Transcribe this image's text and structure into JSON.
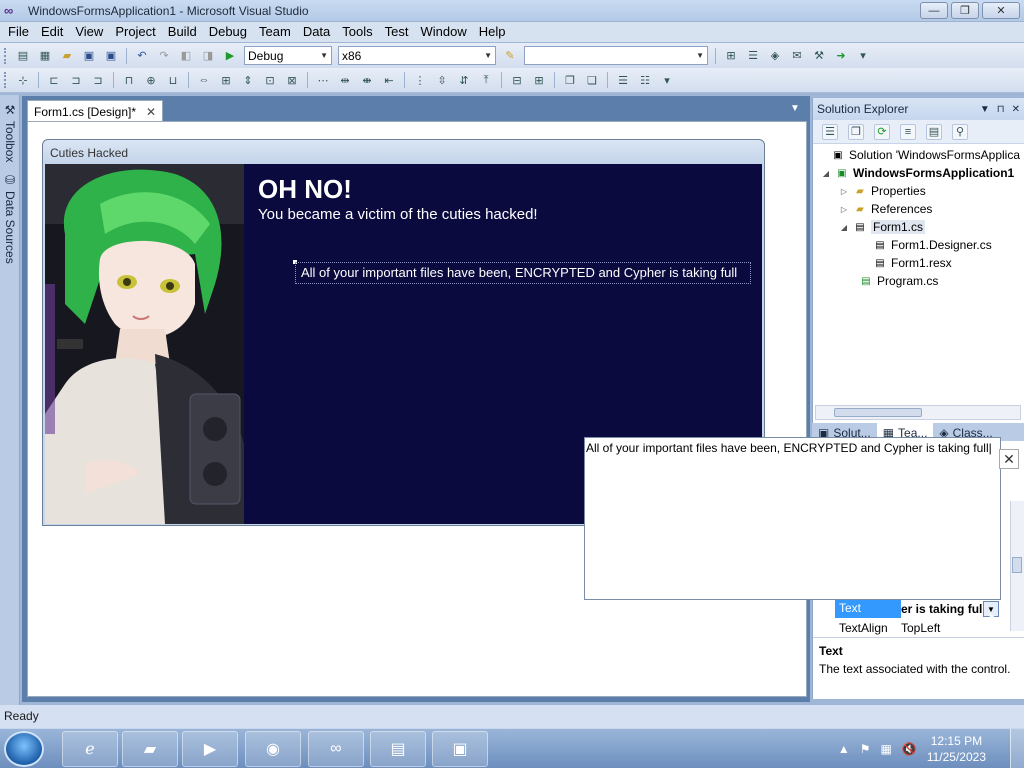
{
  "window": {
    "title": "WindowsFormsApplication1 - Microsoft Visual Studio",
    "minimize": "—",
    "maximize": "❐",
    "close": "✕"
  },
  "menu": [
    "File",
    "Edit",
    "View",
    "Project",
    "Build",
    "Debug",
    "Team",
    "Data",
    "Tools",
    "Test",
    "Window",
    "Help"
  ],
  "toolbar": {
    "config": "Debug",
    "platform": "x86",
    "find_value": ""
  },
  "left_strip": {
    "toolbox": "Toolbox",
    "data_sources": "Data Sources"
  },
  "document_tab": {
    "label": "Form1.cs [Design]*",
    "close": "✕"
  },
  "form": {
    "title": "Cuties Hacked",
    "heading": "OH NO!",
    "subheading": "You became a victim of the cuties hacked!",
    "body_label": "All of your important files have been, ENCRYPTED and Cypher is taking full"
  },
  "solution_explorer": {
    "title": "Solution Explorer",
    "pin": "📌",
    "close": "✕",
    "items": [
      {
        "label": "Solution 'WindowsFormsApplica",
        "exp": ""
      },
      {
        "label": "WindowsFormsApplication1",
        "exp": "◢"
      },
      {
        "label": "Properties",
        "exp": "▷"
      },
      {
        "label": "References",
        "exp": "▷"
      },
      {
        "label": "Form1.cs",
        "exp": "◢"
      },
      {
        "label": "Form1.Designer.cs",
        "exp": ""
      },
      {
        "label": "Form1.resx",
        "exp": ""
      },
      {
        "label": "Program.cs",
        "exp": ""
      }
    ],
    "tabs": [
      "Solut...",
      "Tea...",
      "Class..."
    ]
  },
  "properties": {
    "rows": [
      {
        "name": "Text",
        "value": "er is taking full"
      },
      {
        "name": "TextAlign",
        "value": "TopLeft"
      }
    ],
    "desc_title": "Text",
    "desc_body": "The text associated with the control."
  },
  "text_editor": {
    "value": "All of your important files have been, ENCRYPTED and Cypher is taking full"
  },
  "status": {
    "text": "Ready"
  },
  "taskbar": {
    "time": "12:15 PM",
    "date": "11/25/2023"
  }
}
